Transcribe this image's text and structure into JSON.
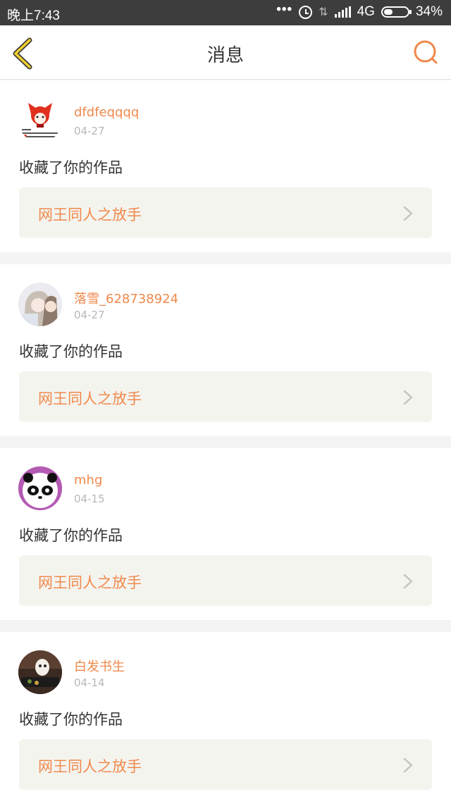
{
  "status_bar": {
    "time": "晚上7:43",
    "dots": "•••",
    "network": "4G",
    "battery": "34%",
    "battery_level": 0.34
  },
  "header": {
    "title": "消息",
    "back_icon": "chevron-left-icon",
    "search_icon": "search-icon",
    "accent_color": "#f0894c"
  },
  "messages": [
    {
      "username": "dfdfeqqqq",
      "date": "04-27",
      "action": "收藏了你的作品",
      "work_title": "网王同人之放手"
    },
    {
      "username": "落雪_628738924",
      "date": "04-27",
      "action": "收藏了你的作品",
      "work_title": "网王同人之放手"
    },
    {
      "username": "mhg",
      "date": "04-15",
      "action": "收藏了你的作品",
      "work_title": "网王同人之放手"
    },
    {
      "username": "白发书生",
      "date": "04-14",
      "action": "收藏了你的作品",
      "work_title": "网王同人之放手"
    }
  ]
}
